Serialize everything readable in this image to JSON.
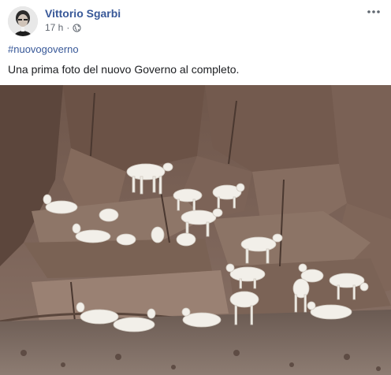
{
  "post": {
    "author": "Vittorio Sgarbi",
    "time": "17 h",
    "separator": "·",
    "hashtag": "#nuovogoverno",
    "caption": "Una prima foto del nuovo Governo al completo.",
    "icons": {
      "privacy": "globe-icon",
      "menu": "more-options-icon"
    }
  },
  "colors": {
    "link": "#385898",
    "text": "#1c1e21",
    "meta": "#606770"
  }
}
